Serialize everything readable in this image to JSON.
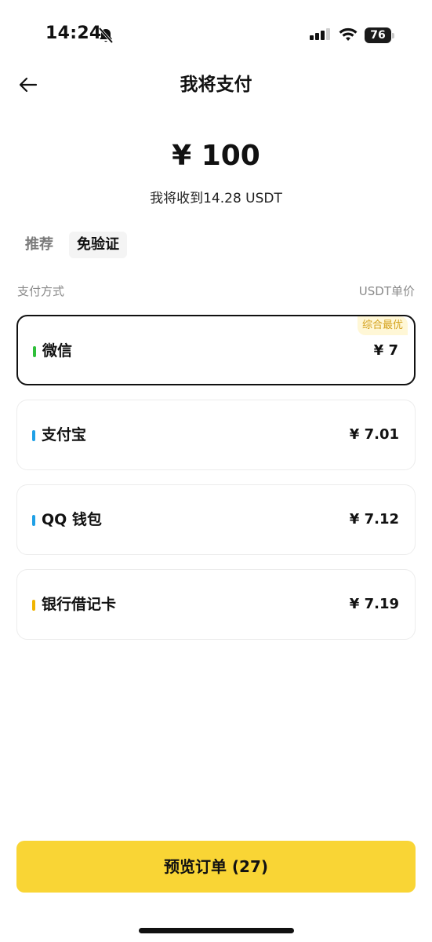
{
  "status_bar": {
    "time": "14:24",
    "battery": "76",
    "icons": [
      "bell-slash-icon",
      "signal-icon",
      "wifi-icon",
      "battery-icon"
    ]
  },
  "header": {
    "title": "我将支付",
    "back_icon": "arrow-left-icon"
  },
  "amount": {
    "pay": "¥ 100",
    "receive": "我将收到14.28 USDT"
  },
  "tabs": [
    {
      "label": "推荐",
      "active": false
    },
    {
      "label": "免验证",
      "active": true
    }
  ],
  "columns": {
    "left": "支付方式",
    "right": "USDT单价"
  },
  "methods": [
    {
      "name": "微信",
      "price": "¥ 7",
      "color": "#2fbf3a",
      "badge": "综合最优",
      "selected": true
    },
    {
      "name": "支付宝",
      "price": "¥ 7.01",
      "color": "#1fa0e6",
      "badge": "",
      "selected": false
    },
    {
      "name": "QQ 钱包",
      "price": "¥ 7.12",
      "color": "#1fa0e6",
      "badge": "",
      "selected": false
    },
    {
      "name": "银行借记卡",
      "price": "¥ 7.19",
      "color": "#f0b400",
      "badge": "",
      "selected": false
    }
  ],
  "cta": {
    "label": "预览订单 (27)",
    "color": "#f9d535"
  }
}
